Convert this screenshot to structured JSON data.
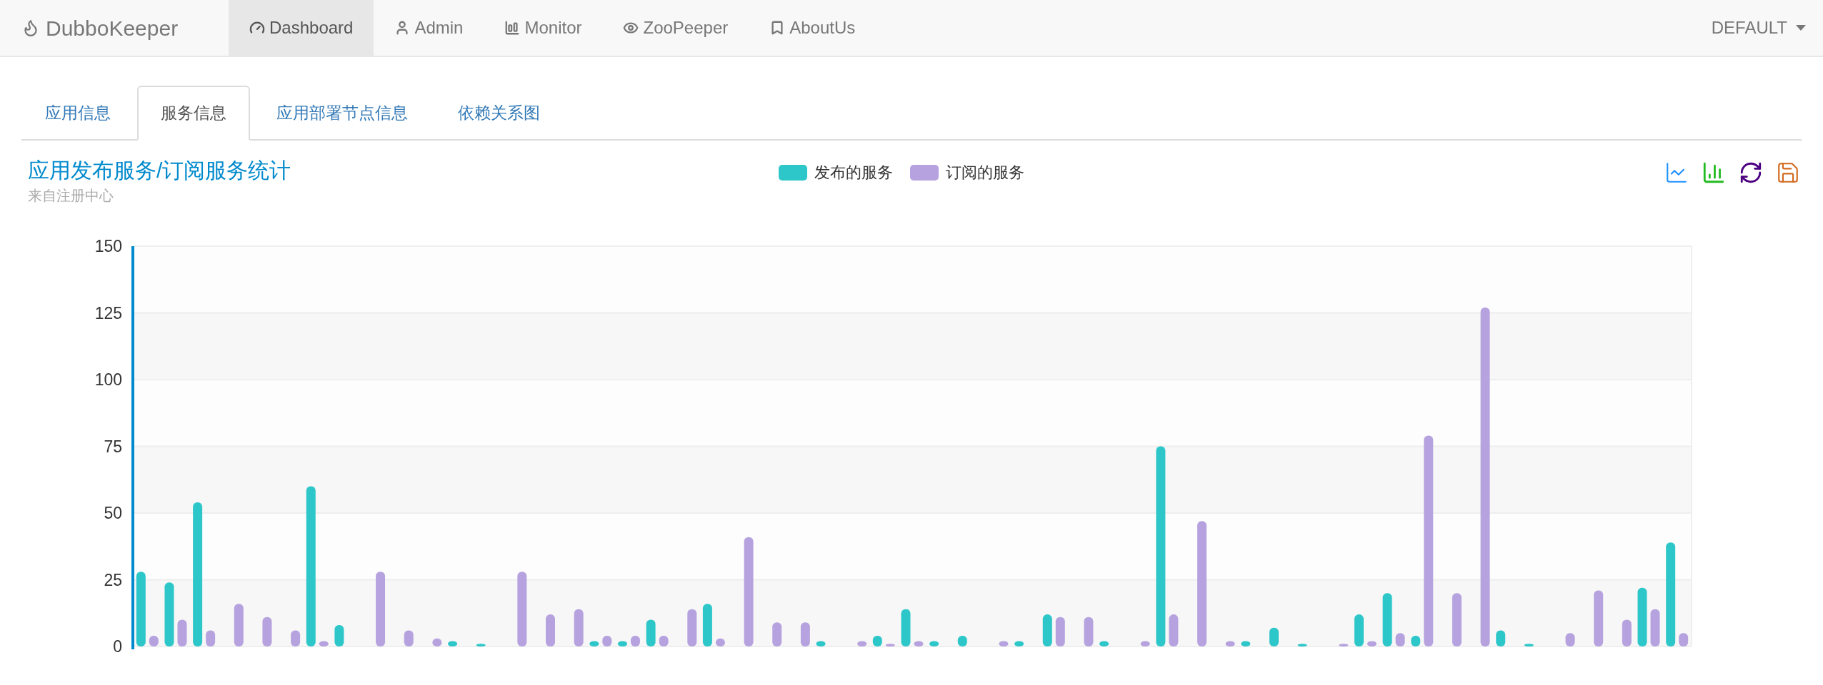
{
  "navbar": {
    "brand": "DubboKeeper",
    "items": [
      {
        "label": "Dashboard",
        "selected": true
      },
      {
        "label": "Admin",
        "selected": false
      },
      {
        "label": "Monitor",
        "selected": false
      },
      {
        "label": "ZooPeeper",
        "selected": false
      },
      {
        "label": "AboutUs",
        "selected": false
      }
    ],
    "user_menu": "DEFAULT"
  },
  "tabs": [
    {
      "label": "应用信息",
      "selected": false
    },
    {
      "label": "服务信息",
      "selected": true
    },
    {
      "label": "应用部署节点信息",
      "selected": false
    },
    {
      "label": "依赖关系图",
      "selected": false
    }
  ],
  "chart": {
    "title": "应用发布服务/订阅服务统计",
    "subtitle": "来自注册中心",
    "chart_data": {
      "type": "bar",
      "grid": true,
      "ylim": [
        0,
        150
      ],
      "yticks": [
        0,
        25,
        50,
        75,
        100,
        125,
        150
      ],
      "series": [
        {
          "name": "发布的服务",
          "color": "#2ec7c9",
          "values": [
            28,
            24,
            54,
            0,
            0,
            0,
            60,
            8,
            0,
            0,
            0,
            2,
            1,
            0,
            0,
            0,
            2,
            2,
            10,
            0,
            16,
            0,
            0,
            0,
            2,
            0,
            4,
            14,
            2,
            4,
            0,
            2,
            12,
            0,
            2,
            0,
            75,
            0,
            0,
            2,
            7,
            1,
            0,
            12,
            20,
            4,
            0,
            0,
            6,
            1,
            0,
            0,
            0,
            22,
            39
          ]
        },
        {
          "name": "订阅的服务",
          "color": "#b6a2de",
          "values": [
            4,
            10,
            6,
            16,
            11,
            6,
            2,
            0,
            28,
            6,
            3,
            0,
            0,
            28,
            12,
            14,
            4,
            4,
            4,
            14,
            3,
            41,
            9,
            9,
            0,
            2,
            1,
            2,
            0,
            0,
            2,
            0,
            11,
            11,
            0,
            2,
            12,
            47,
            2,
            0,
            0,
            0,
            1,
            2,
            5,
            79,
            20,
            127,
            0,
            0,
            5,
            21,
            10,
            14,
            5
          ]
        }
      ]
    }
  }
}
